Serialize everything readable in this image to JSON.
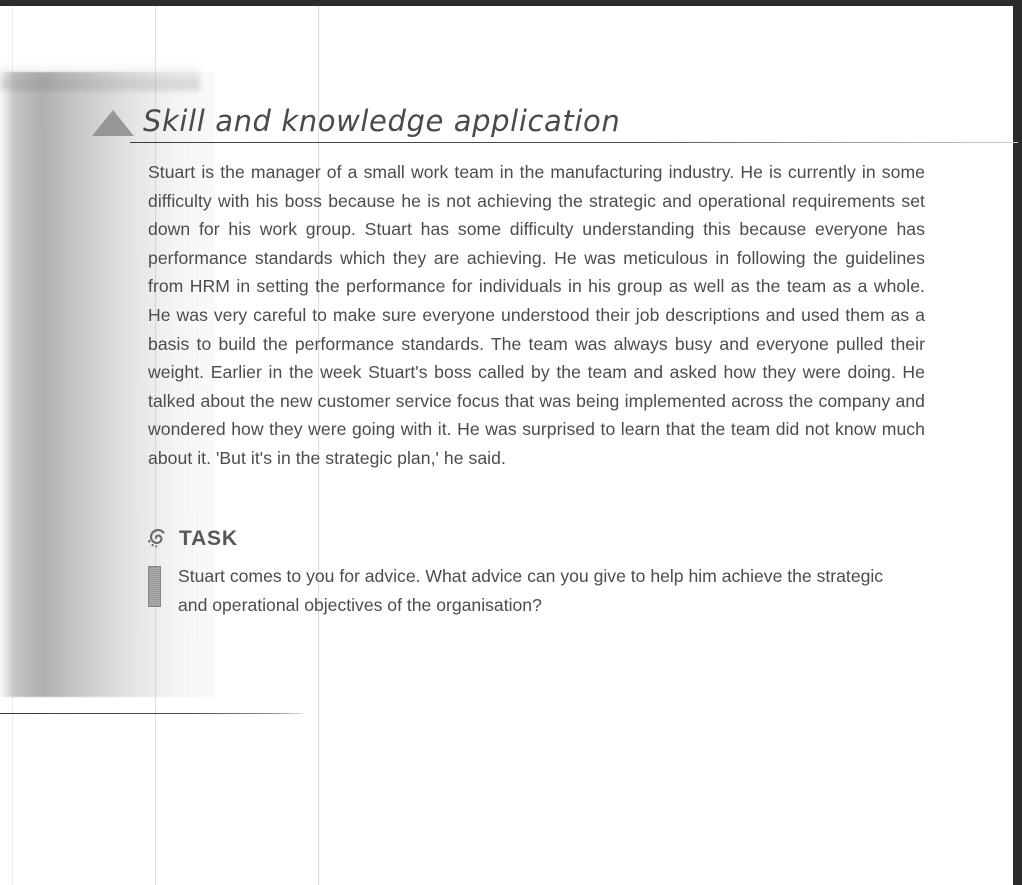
{
  "document": {
    "section_heading": "Skill and knowledge application",
    "case_study_paragraph": "Stuart is the manager of a small work team in the manufacturing industry. He is currently in some difficulty with his boss because he is not achieving the strategic and operational requirements set down for his work group. Stuart has some difficulty understanding this because everyone has performance standards which they are achieving. He was meticulous in following the guidelines from HRM in setting the performance for individuals in his group as well as the team as a whole. He was very careful to make sure everyone understood their job descriptions and used them as a basis to build the performance standards. The team was always busy and everyone pulled their weight. Earlier in the week Stuart's boss called by the team and asked how they were doing. He talked about the new customer service focus that was being implemented across the company and wondered how they were going with it. He was surprised to learn that the team did not know much about it. 'But it's in the strategic plan,' he said.",
    "task": {
      "label": "TASK",
      "text": "Stuart comes to you for advice. What advice can you give to help him achieve the strategic and operational objectives of the organisation?"
    },
    "icons": {
      "heading_marker": "triangle-icon",
      "task_marker": "spiral-icon",
      "task_bullet": "vertical-bar-icon"
    },
    "colors": {
      "text": "#4c4c4e",
      "heading": "#4a4a4c",
      "rule": "#4a4a4c",
      "scan_edge": "#2c2c2e",
      "marker_gray": "#8c8c8e"
    }
  }
}
